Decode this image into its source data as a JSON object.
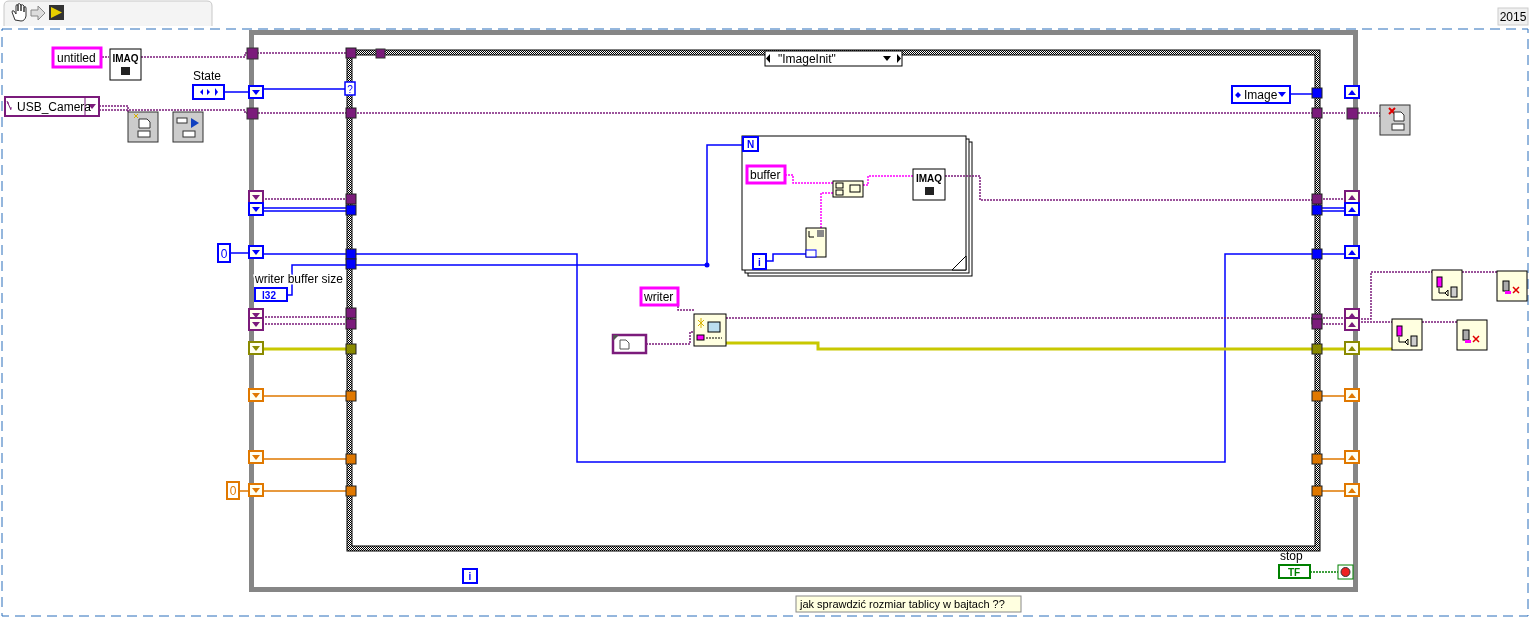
{
  "toolbar": {
    "version": "2015"
  },
  "diagram": {
    "string_constants": [
      {
        "text": "untitled"
      },
      {
        "text": "buffer"
      },
      {
        "text": "writer"
      }
    ],
    "camera_selector": {
      "value": "USB_Camera"
    },
    "state_control": {
      "label": "State"
    },
    "numeric_constants": [
      {
        "text": "0"
      },
      {
        "text": "0"
      }
    ],
    "buffer_size_control": {
      "label": "writer buffer size",
      "type": "I32"
    },
    "imaq_nodes": [
      {
        "text": "IMAQ"
      },
      {
        "text": "IMAQ"
      }
    ],
    "case_structure": {
      "selector": "\"ImageInit\"",
      "selector_terminal": "?"
    },
    "image_enum": {
      "value": "Image"
    },
    "for_loop": {
      "count": "N",
      "index": "i"
    },
    "while_loop": {
      "index": "i"
    },
    "stop_button": {
      "label": "stop",
      "text": "TF"
    },
    "comment": "jak sprawdzić rozmiar tablicy w bajtach ??"
  }
}
